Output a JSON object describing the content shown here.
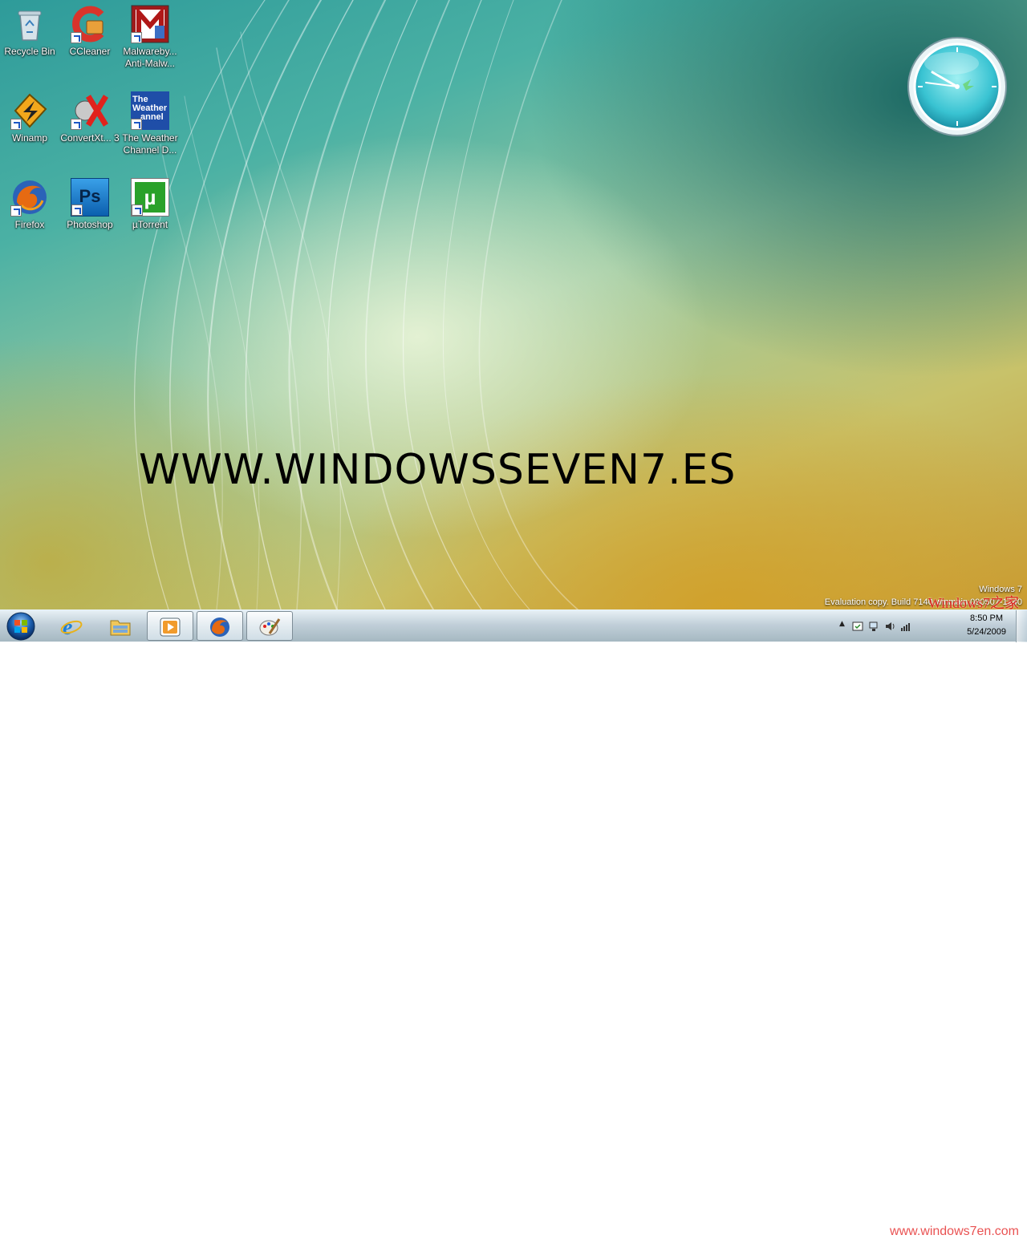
{
  "desktop": {
    "watermark_url": "WWW.WINDOWSSEVEN7.ES",
    "icons": [
      {
        "label": "Recycle Bin",
        "icon": "recycle-bin-icon"
      },
      {
        "label": "CCleaner",
        "icon": "ccleaner-icon"
      },
      {
        "label": "Malwareby... Anti-Malw...",
        "icon": "malwarebytes-icon"
      },
      {
        "label": "Winamp",
        "icon": "winamp-icon"
      },
      {
        "label": "ConvertXt... 3",
        "icon": "convertx-icon"
      },
      {
        "label": "The Weather Channel D...",
        "icon": "weather-channel-icon"
      },
      {
        "label": "Firefox",
        "icon": "firefox-icon"
      },
      {
        "label": "Photoshop",
        "icon": "photoshop-icon"
      },
      {
        "label": "µTorrent",
        "icon": "utorrent-icon"
      }
    ],
    "weather_icon_text": {
      "line1": "The",
      "line2": "Weather",
      "line3": "annel"
    },
    "evaluation": {
      "line1": "Windows 7",
      "line2": "Evaluation copy. Build 7140.winmain.090507-1240"
    },
    "site_watermark": "Windows7之家",
    "site_watermark2": "www.windows7en.com"
  },
  "taskbar": {
    "start_label": "Start",
    "pinned": [
      {
        "name": "Internet Explorer",
        "icon": "internet-explorer-icon"
      },
      {
        "name": "Windows Explorer",
        "icon": "folder-icon"
      },
      {
        "name": "Windows Media Player",
        "icon": "media-player-icon"
      },
      {
        "name": "Firefox",
        "icon": "firefox-icon"
      },
      {
        "name": "Paint",
        "icon": "paint-icon"
      }
    ],
    "clock": {
      "time": "8:50 PM",
      "date": "5/24/2009"
    }
  },
  "colors": {
    "watermark_red": "#e21818",
    "taskbar": "#bfcdd7",
    "shortcut_arrow": "#1d58c4"
  }
}
